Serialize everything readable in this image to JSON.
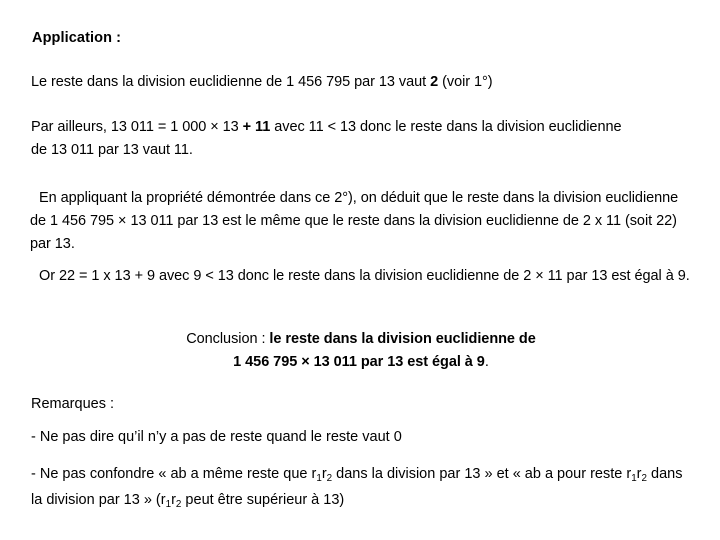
{
  "slide": {
    "background_color": "#ffffff",
    "text_color": "#000000",
    "title": "Application :",
    "paragraphs": {
      "p1": {
        "before": "Le reste dans la division euclidienne de 1 456 795 par 13 vaut ",
        "bold": "2",
        "after": " (voir 1°)"
      },
      "p2": {
        "before": "Par ailleurs, 13 011 = 1 000 × 13 ",
        "bold": "+ 11",
        "after": " avec 11 < 13 donc le reste dans la division euclidienne de 13 011 par 13 vaut 11."
      },
      "p3": {
        "text": "En appliquant la propriété démontrée dans ce 2°), on déduit que le reste dans la division euclidienne de 1 456 795 × 13 011 par 13 est le même que le reste dans la division euclidienne de 2 x 11 (soit 22) par 13."
      },
      "p4": {
        "text": "Or 22 = 1 x 13 + 9 avec 9 < 13 donc le reste dans la division euclidienne de 2 × 11 par 13 est égal à 9."
      }
    },
    "conclusion": {
      "label": "Conclusion : ",
      "bold_line1": "le reste dans la division euclidienne de",
      "bold_line2": "1 456 795 × 13 011 par 13 est égal à 9",
      "period": "."
    },
    "remarks": {
      "heading": "Remarques :",
      "items": [
        {
          "text": "- Ne pas dire qu’il n’y a pas de reste quand le reste vaut 0"
        },
        {
          "seg1": "- Ne pas confondre « ab a même reste que r",
          "sub1": "1",
          "seg2": "r",
          "sub2": "2",
          "seg3": " dans la division par 13 » et « ab a pour reste r",
          "sub3": "1",
          "seg4": "r",
          "sub4": "2",
          "seg5": " dans la division par 13 »  (r",
          "sub5": "1",
          "seg6": "r",
          "sub6": "2",
          "seg7": " peut être supérieur à 13)"
        }
      ]
    }
  }
}
